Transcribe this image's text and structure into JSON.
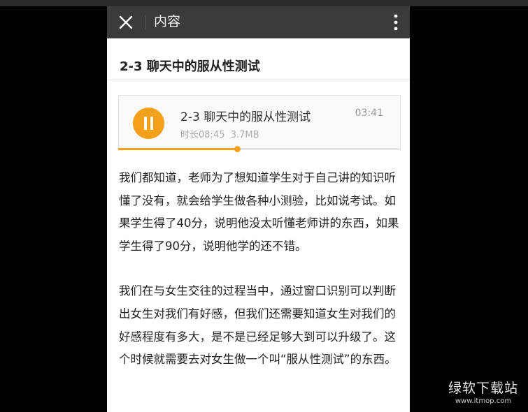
{
  "appbar": {
    "title": "内容",
    "close_icon": "close-icon",
    "more_icon": "more-vertical-icon"
  },
  "article": {
    "title": "2-3 聊天中的服从性测试",
    "paragraphs": [
      "我们都知道，老师为了想知道学生对于自己讲的知识听懂了没有，就会给学生做各种小测验，比如说考试。如果学生得了40分，说明他没太听懂老师讲的东西，如果学生得了90分，说明他学的还不错。",
      "我们在与女生交往的过程当中，通过窗口识别可以判断出女生对我们有好感，但我们还需要知道女生对我们的好感程度有多大，是不是已经足够大到可以升级了。这个时候就需要去对女生做一个叫“服从性测试”的东西。"
    ]
  },
  "audio": {
    "title": "2-3 聊天中的服从性测试",
    "current_time": "03:41",
    "meta": "时长08:45  3.7MB",
    "progress_fraction": 0.42,
    "play_icon": "pause-icon",
    "accent_color": "#f5a01a"
  },
  "watermark": {
    "main": "绿软下载站",
    "sub": "www.itmop.com"
  }
}
